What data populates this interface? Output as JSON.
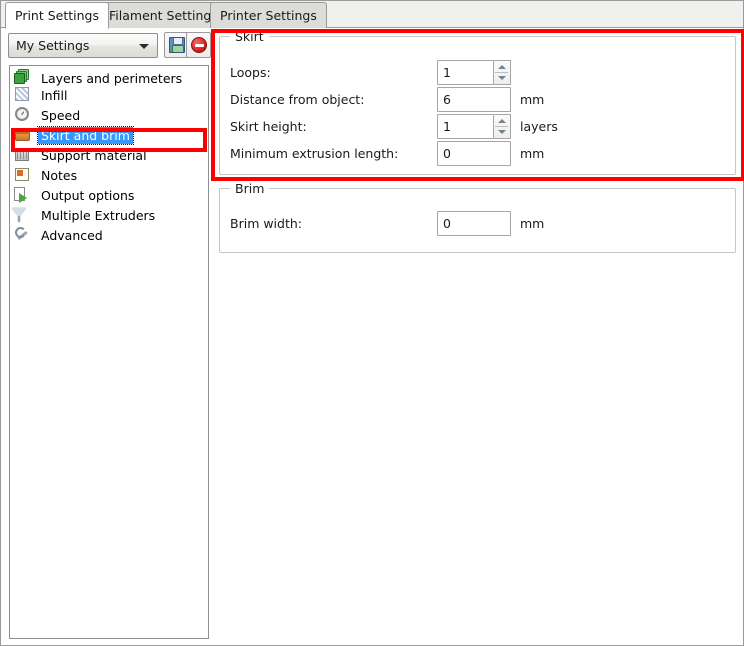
{
  "window": {
    "title": "Print Settings"
  },
  "tabs": [
    {
      "label": "Print Settings",
      "active": true
    },
    {
      "label": "Filament Settings",
      "active": false
    },
    {
      "label": "Printer Settings",
      "active": false
    }
  ],
  "toolbar": {
    "preset_selected": "My Settings",
    "preset_dropdown_icon": "chevron-down-icon",
    "save_icon": "floppy-save-icon",
    "delete_icon": "delete-circle-icon"
  },
  "sidebar": {
    "items": [
      {
        "label": "Layers and perimeters",
        "icon": "layers-icon",
        "selected": false
      },
      {
        "label": "Infill",
        "icon": "infill-hatch-icon",
        "selected": false
      },
      {
        "label": "Speed",
        "icon": "speedometer-icon",
        "selected": false
      },
      {
        "label": "Skirt and brim",
        "icon": "skirt-box-icon",
        "selected": true
      },
      {
        "label": "Support material",
        "icon": "support-material-icon",
        "selected": false
      },
      {
        "label": "Notes",
        "icon": "notes-icon",
        "selected": false
      },
      {
        "label": "Output options",
        "icon": "output-arrow-icon",
        "selected": false
      },
      {
        "label": "Multiple Extruders",
        "icon": "funnel-icon",
        "selected": false
      },
      {
        "label": "Advanced",
        "icon": "wrench-icon",
        "selected": false
      }
    ]
  },
  "panel": {
    "groups": [
      {
        "title": "Skirt",
        "fields": [
          {
            "label": "Loops:",
            "value": "1",
            "unit": "",
            "spinner": true
          },
          {
            "label": "Distance from object:",
            "value": "6",
            "unit": "mm",
            "spinner": false
          },
          {
            "label": "Skirt height:",
            "value": "1",
            "unit": "layers",
            "spinner": true
          },
          {
            "label": "Minimum extrusion length:",
            "value": "0",
            "unit": "mm",
            "spinner": false
          }
        ]
      },
      {
        "title": "Brim",
        "fields": [
          {
            "label": "Brim width:",
            "value": "0",
            "unit": "mm",
            "spinner": false
          }
        ]
      }
    ]
  },
  "annotations": {
    "highlight_color": "#ff0000",
    "boxes": [
      {
        "name": "skirt-panel-highlight"
      },
      {
        "name": "skirt-and-brim-item-highlight"
      }
    ]
  }
}
